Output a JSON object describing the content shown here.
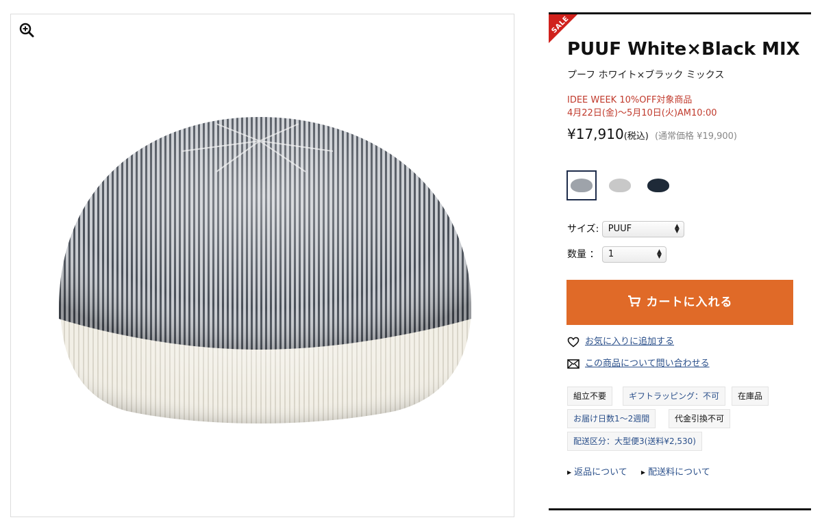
{
  "product": {
    "sale_badge": "SALE",
    "title": "PUUF White×Black MIX",
    "subtitle": "プーフ ホワイト×ブラック ミックス",
    "campaign_line1": "IDEE WEEK 10%OFF対象商品",
    "campaign_line2": "4月22日(金)〜5月10日(火)AM10:00",
    "price": "¥17,910",
    "tax_note": "(税込)",
    "regular_price": "(通常価格 ¥19,900)"
  },
  "swatches": [
    {
      "name": "white-black-mix",
      "color": "#9ea3aa",
      "selected": true
    },
    {
      "name": "grey",
      "color": "#c8c8c8",
      "selected": false
    },
    {
      "name": "navy",
      "color": "#1e2a38",
      "selected": false
    }
  ],
  "options": {
    "size_label": "サイズ:",
    "size_value": "PUUF",
    "qty_label": "数量 ：",
    "qty_value": "1"
  },
  "actions": {
    "cart_label": "カートに入れる",
    "favorite_label": "お気に入りに追加する",
    "inquiry_label": "この商品について問い合わせる"
  },
  "tags": {
    "assembly": "組立不要",
    "gift": "ギフトラッピング：不可",
    "stock": "在庫品",
    "delivery_days": "お届け日数1〜2週間",
    "cod": "代金引換不可",
    "shipping": "配送区分：大型便3(送料¥2,530)"
  },
  "footer_links": {
    "returns": "返品について",
    "shipping_fee": "配送料について"
  },
  "colors": {
    "accent_orange": "#e06a28",
    "sale_red": "#d0211c",
    "campaign_red": "#c0392b",
    "link_blue": "#2a4f8a"
  },
  "icons": [
    "zoom-in-icon",
    "cart-icon",
    "heart-icon",
    "mail-icon"
  ]
}
